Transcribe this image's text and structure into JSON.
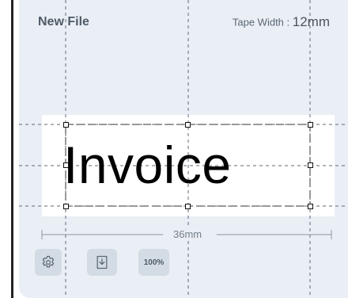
{
  "header": {
    "title": "New File",
    "tape_width_label": "Tape Width :",
    "tape_width_value": "12mm"
  },
  "label": {
    "text": "Invoice"
  },
  "ruler": {
    "length_label": "36mm"
  },
  "toolbar": {
    "settings_icon": "gear-icon",
    "import_icon": "download-icon",
    "zoom_label": "100%"
  },
  "colors": {
    "background": "#eaeff5",
    "button": "#d3dbe4",
    "text_primary": "#4f5b67"
  }
}
